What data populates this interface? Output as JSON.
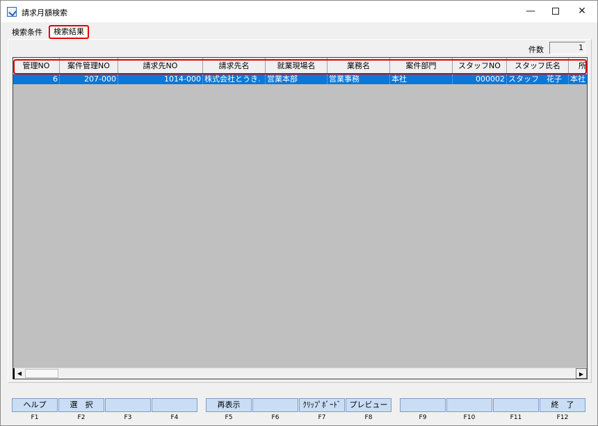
{
  "window": {
    "title": "請求月額検索",
    "minimize": "—",
    "close": "✕"
  },
  "tabs": [
    {
      "label": "検索条件"
    },
    {
      "label": "検索結果"
    }
  ],
  "count": {
    "label": "件数",
    "value": "1"
  },
  "grid": {
    "columns": [
      "管理NO",
      "案件管理NO",
      "請求先NO",
      "請求先名",
      "就業現場名",
      "業務名",
      "案件部門",
      "スタッフNO",
      "スタッフ氏名",
      "所"
    ],
    "rows": [
      [
        "6",
        "207-000",
        "1014-000",
        "株式会社とうき.",
        "営業本部",
        "営業事務",
        "本社",
        "000002",
        "スタッフ　花子",
        "本社"
      ]
    ]
  },
  "scrollbar": {
    "left_arrow": "◀",
    "right_arrow": "▶"
  },
  "function_keys": [
    {
      "label": "ヘルプ",
      "key": "F1"
    },
    {
      "label": "選　択",
      "key": "F2"
    },
    {
      "label": "",
      "key": "F3"
    },
    {
      "label": "",
      "key": "F4"
    },
    {
      "label": "再表示",
      "key": "F5"
    },
    {
      "label": "",
      "key": "F6"
    },
    {
      "label": "ｸﾘｯﾌﾟﾎﾞｰﾄﾞ",
      "key": "F7"
    },
    {
      "label": "プレビュー",
      "key": "F8"
    },
    {
      "label": "",
      "key": "F9"
    },
    {
      "label": "",
      "key": "F10"
    },
    {
      "label": "",
      "key": "F11"
    },
    {
      "label": "終　了",
      "key": "F12"
    }
  ],
  "colors": {
    "selected_row": "#0a78d7",
    "highlight": "#e00000",
    "fkey_bg": "#c9def5",
    "grid_bg": "#c0c0c0"
  }
}
